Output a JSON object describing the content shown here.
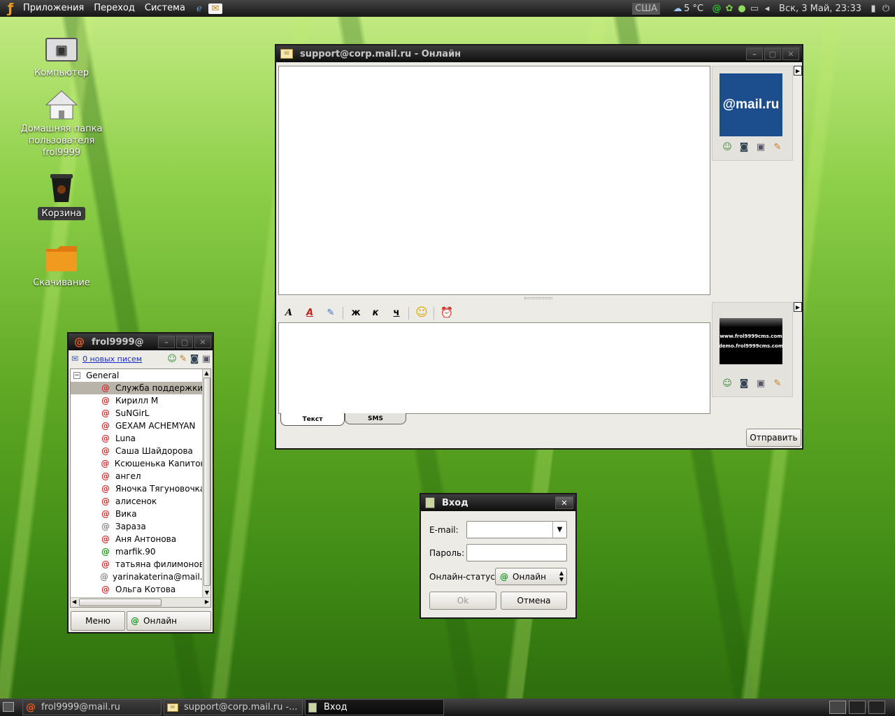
{
  "top_panel": {
    "menus": [
      "Приложения",
      "Переход",
      "Система"
    ],
    "keyboard_layout": "США",
    "weather": "5 °C",
    "clock": "Вск,  3 Май, 23:33"
  },
  "desktop": {
    "icons": [
      "Компьютер",
      "Домашняя папка пользователя frol9999",
      "Корзина",
      "Скачивание"
    ]
  },
  "contacts_window": {
    "title": "frol9999@",
    "new_mail": "0 новых писем",
    "group": "General",
    "contacts": [
      "Служба поддержки",
      "Кирилл М",
      "SuNGirL",
      "GEXAM ACHEMYAN",
      "Luna",
      "Саша Шайдорова",
      "Ксюшенька Капитонс",
      "ангел",
      "Яночка Тягуновочка",
      "алисенок",
      "Вика",
      "Зараза",
      "Аня Антонова",
      "marfik.90",
      "татьяна филимонова",
      "yarinakaterina@mail.ru",
      "Ольга Котова"
    ],
    "contact_status": [
      "red",
      "red",
      "red",
      "red",
      "red",
      "red",
      "red",
      "red",
      "red",
      "red",
      "red",
      "gray",
      "red",
      "green",
      "red",
      "gray",
      "red"
    ],
    "menu_button": "Меню",
    "status_button": "Онлайн"
  },
  "chat_window": {
    "title": "support@corp.mail.ru - Онлайн",
    "avatar_text": "@mail.ru",
    "avatar2_lines": [
      "www.frol9999cms.com",
      "demo.frol9999cms.com"
    ],
    "format_letters": {
      "bold": "ж",
      "italic": "к",
      "underline": "ч"
    },
    "tabs": [
      "Текст",
      "SMS"
    ],
    "send_button": "Отправить"
  },
  "login_dialog": {
    "title": "Вход",
    "email_label": "E-mail:",
    "password_label": "Пароль:",
    "status_label": "Онлайн-статус:",
    "status_value": "Онлайн",
    "ok_button": "Ok",
    "cancel_button": "Отмена"
  },
  "taskbar": {
    "items": [
      "frol9999@mail.ru",
      "support@corp.mail.ru -...",
      "Вход"
    ]
  }
}
